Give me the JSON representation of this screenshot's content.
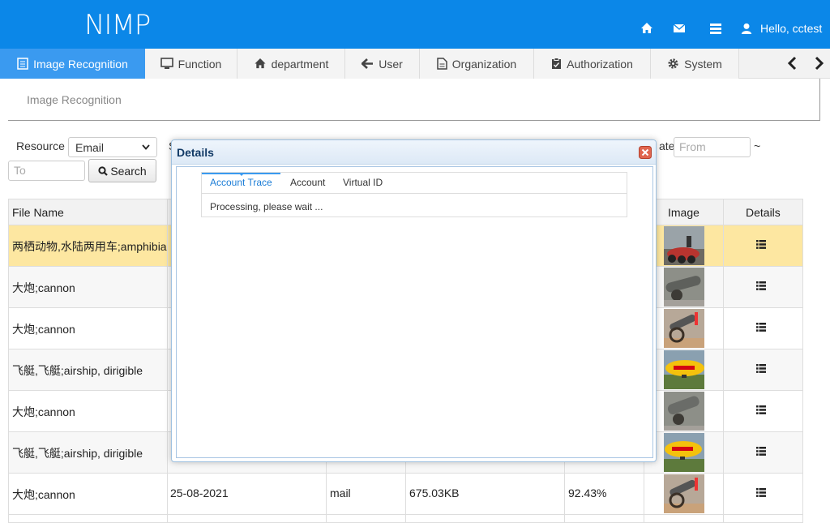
{
  "header": {
    "logo": "NIMP",
    "greeting": "Hello, cctest",
    "icons": [
      "home-icon",
      "mail-icon",
      "list-icon",
      "user-icon"
    ],
    "color": "#0b87e8"
  },
  "nav": {
    "tabs": [
      {
        "label": "Image Recognition",
        "icon": "document-icon",
        "active": true
      },
      {
        "label": "Function",
        "icon": "monitor-icon"
      },
      {
        "label": "department",
        "icon": "home-icon"
      },
      {
        "label": "User",
        "icon": "arrow-left-icon"
      },
      {
        "label": "Organization",
        "icon": "file-icon"
      },
      {
        "label": "Authorization",
        "icon": "clipboard-icon"
      },
      {
        "label": "System",
        "icon": "gear-icon"
      }
    ]
  },
  "breadcrumb": "Image Recognition",
  "filters": {
    "resource_label": "Resource",
    "resource_value": "Email",
    "partial_label_s": "S",
    "date_label_tail": "ate",
    "from_placeholder": "From",
    "tilde": "~",
    "to_placeholder": "To",
    "search_label": "Search"
  },
  "table": {
    "headers": {
      "file_name": "File Name",
      "image": "Image",
      "details": "Details"
    },
    "rows": [
      {
        "file_name": "两栖动物,水陆两用车;amphibia",
        "date": "",
        "source": "",
        "size": "",
        "score": "",
        "highlight": true
      },
      {
        "file_name": "大炮;cannon",
        "date": "",
        "source": "",
        "size": "",
        "score": ""
      },
      {
        "file_name": "大炮;cannon",
        "date": "",
        "source": "",
        "size": "",
        "score": ""
      },
      {
        "file_name": "飞艇,飞艇;airship, dirigible",
        "date": "",
        "source": "",
        "size": "",
        "score": ""
      },
      {
        "file_name": "大炮;cannon",
        "date": "",
        "source": "",
        "size": "",
        "score": ""
      },
      {
        "file_name": "飞艇,飞艇;airship, dirigible",
        "date": "",
        "source": "",
        "size": "",
        "score": ""
      },
      {
        "file_name": "大炮;cannon",
        "date": "25-08-2021",
        "source": "mail",
        "size": "675.03KB",
        "score": "92.43%"
      }
    ]
  },
  "modal": {
    "title": "Details",
    "tabs": [
      "Account Trace",
      "Account",
      "Virtual ID"
    ],
    "active_tab": "Account Trace",
    "status": "Processing, please wait ..."
  }
}
